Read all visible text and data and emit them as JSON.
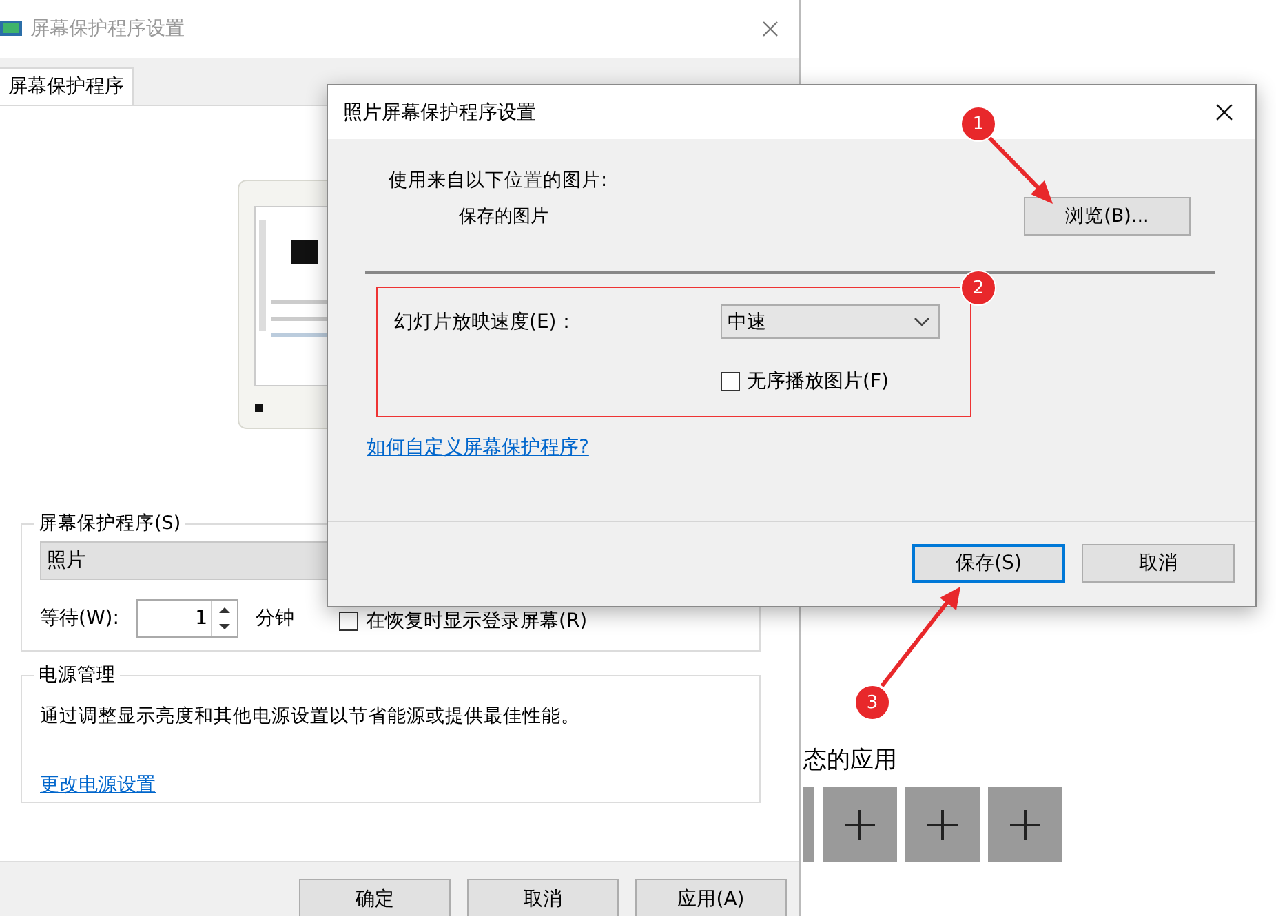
{
  "background_page": {
    "section_heading": "态的应用",
    "app_tiles": [
      {
        "kind": "edge"
      },
      {
        "kind": "add"
      },
      {
        "kind": "add"
      },
      {
        "kind": "add"
      }
    ]
  },
  "main_window": {
    "title": "屏幕保护程序设置",
    "tab": {
      "label": "屏幕保护程序",
      "selected": true
    },
    "screensaver_group": {
      "legend": "屏幕保护程序(S)",
      "selected_screensaver": "照片",
      "wait_label": "等待(W):",
      "wait_value": "1",
      "unit": "分钟",
      "resume_checkbox": {
        "label": "在恢复时显示登录屏幕(R)",
        "checked": false
      }
    },
    "power_group": {
      "legend": "电源管理",
      "description": "通过调整显示亮度和其他电源设置以节省能源或提供最佳性能。",
      "link": "更改电源设置"
    },
    "buttons": [
      "确定",
      "取消",
      "应用(A)"
    ]
  },
  "photo_dialog": {
    "title": "照片屏幕保护程序设置",
    "source_label": "使用来自以下位置的图片:",
    "source_value": "保存的图片",
    "browse_button": "浏览(B)...",
    "speed_label": "幻灯片放映速度(E)：",
    "speed_value": "中速",
    "shuffle_checkbox": {
      "label": "无序播放图片(F)",
      "checked": false
    },
    "help_link": "如何自定义屏幕保护程序?",
    "buttons": [
      {
        "label": "保存(S)",
        "default": true
      },
      {
        "label": "取消",
        "default": false
      }
    ]
  },
  "annotations": [
    {
      "number": "1"
    },
    {
      "number": "2"
    },
    {
      "number": "3"
    }
  ]
}
